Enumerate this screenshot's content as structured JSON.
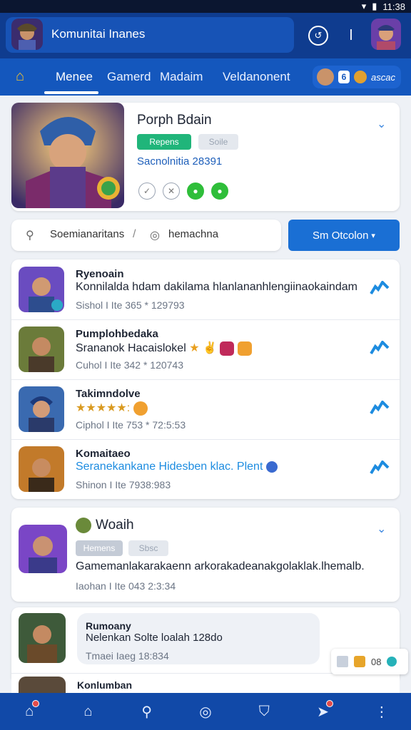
{
  "statusbar": {
    "time": "11:38"
  },
  "appbar": {
    "title": "Komunitai Inanes"
  },
  "tabs": [
    {
      "label": "Menee"
    },
    {
      "label": "Gamerd"
    },
    {
      "label": "Madaim"
    },
    {
      "label": "Veldanonent"
    }
  ],
  "tabpill": {
    "count": "6",
    "text": "ascac"
  },
  "featured": {
    "name": "Porph Bdain",
    "badge_primary": "Repens",
    "badge_secondary": "Soile",
    "stat": "Sacnolnitia 28391"
  },
  "searchbar": {
    "left_text": "Soemianaritans",
    "right_text": "hemachna"
  },
  "dropdown": {
    "label": "Sm Otcolon"
  },
  "list": [
    {
      "name": "Ryenoain",
      "desc": "Konnilalda hdam dakilama hlanlananhlengiinaokaindam",
      "meta": "Sishol I Ite  365 * 129793"
    },
    {
      "name": "Pumplohbedaka",
      "desc": "Srananok Hacaislokel",
      "meta": "Cuhol I Ite  342 * 120743"
    },
    {
      "name": "Takimndolve",
      "desc": "★★★★★:",
      "meta": "Ciphol I Ite  753 * 72:5:53"
    },
    {
      "name": "Komaitaeo",
      "desc": "Seranekankane Hidesben klac. Plent",
      "meta": "Shinon I Ite  7938:983"
    }
  ],
  "post": {
    "title": "Woaih",
    "badge_primary": "Hemens",
    "badge_secondary": "Sbsc",
    "text": "Gamemanlakarakaenn arkorakadeanakgolaklak.lhemalb.",
    "meta": "Iaohan I Ite  043  2:3:34"
  },
  "chat": {
    "name": "Rumoany",
    "text": "Nelenkan Solte loalah 128do",
    "meta": "Tmaei Iaeg  18:834"
  },
  "chat2": {
    "name": "Konlumban"
  },
  "floating": {
    "count": "08"
  },
  "colors": {
    "appbar": "#0f3c8f",
    "tabs": "#1457bd",
    "accent": "#1a6fd4",
    "green": "#20b57a",
    "bottomnav": "#1149a8"
  }
}
